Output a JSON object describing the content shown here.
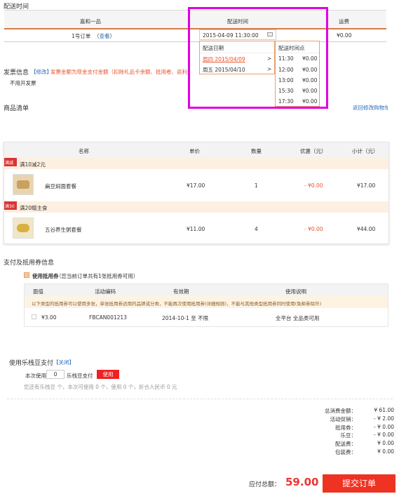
{
  "delivery": {
    "section_title": "配送时间",
    "col_store": "嘉和一品",
    "col_time": "配送时间",
    "col_fee": "运费",
    "order_label": "1号订单",
    "view_link": "查看",
    "selected_time": "2015-04-09  11:30:00",
    "fee": "¥0.00",
    "date_header": "配送日期",
    "time_header": "配送时间点",
    "dates": [
      {
        "label": "周四  2015/04/09",
        "selected": true
      },
      {
        "label": "周五  2015/04/10",
        "selected": false
      }
    ],
    "times": [
      {
        "t": "11:30",
        "p": "¥0.00"
      },
      {
        "t": "12:00",
        "p": "¥0.00"
      },
      {
        "t": "13:00",
        "p": "¥0.00"
      },
      {
        "t": "15:30",
        "p": "¥0.00"
      },
      {
        "t": "17:30",
        "p": "¥0.00"
      }
    ],
    "highlight_color": "#e000e0"
  },
  "invoice": {
    "title": "发票信息",
    "modify": "【修改】",
    "note": "发票金额为现金支付金额（扣除礼品卡余额、抵用卷、返利金额等）",
    "value": "不用开发票"
  },
  "products": {
    "title": "商品清单",
    "back_link": "返回修改购物车",
    "headers": [
      "名称",
      "单价",
      "数量",
      "优惠（元）",
      "小计（元）"
    ],
    "groups": [
      {
        "badge": "满减",
        "promo": "满10减2元",
        "item": {
          "name": "扁豆焖面套餐",
          "price": "¥17.00",
          "qty": "1",
          "discount": "- ¥0.00",
          "subtotal": "¥17.00"
        }
      },
      {
        "badge": "满30",
        "promo": "满20赠主食",
        "item": {
          "name": "五谷养生粥套餐",
          "price": "¥11.00",
          "qty": "4",
          "discount": "- ¥0.00",
          "subtotal": "¥44.00"
        }
      }
    ]
  },
  "coupon": {
    "title": "支付及抵用券信息",
    "use_label": "使用抵用券",
    "use_note": "（您当前订单共有1张抵用券可用）",
    "headers": [
      "面值",
      "活动编码",
      "有效期",
      "使用说明"
    ],
    "notice": "以下类型的抵用券可以使用多张，单张抵用券适用的品牌或分类，不能再次使用抵用券(详细规则)，不能与其他类型抵用券同时使用(免邮券除外)",
    "row": {
      "value": "¥3.00",
      "code": "FBCAN001213",
      "validity": "2014-10-1 至 不限",
      "desc": "全平台 全品类可用"
    }
  },
  "beans": {
    "title": "使用乐栈豆支付",
    "close": "【关闭】",
    "use_label": "本次使用",
    "input_value": "0",
    "unit": "乐栈豆支付",
    "btn": "使用",
    "info": "您还有乐栈豆 个，本次可使用 0 个，使用 0 个，折合人民币 0 元"
  },
  "summary": {
    "rows": [
      {
        "k": "总消费金额：",
        "v": "¥ 61.00"
      },
      {
        "k": "活动促销：",
        "v": "- ¥ 2.00"
      },
      {
        "k": "抵用券：",
        "v": "- ¥ 0.00"
      },
      {
        "k": "乐豆：",
        "v": "- ¥ 0.00"
      },
      {
        "k": "配送费：",
        "v": "¥ 0.00"
      },
      {
        "k": "包装费：",
        "v": "¥ 0.00"
      }
    ],
    "total_label": "应付总额：",
    "total": "59.00",
    "submit": "提交订单"
  }
}
